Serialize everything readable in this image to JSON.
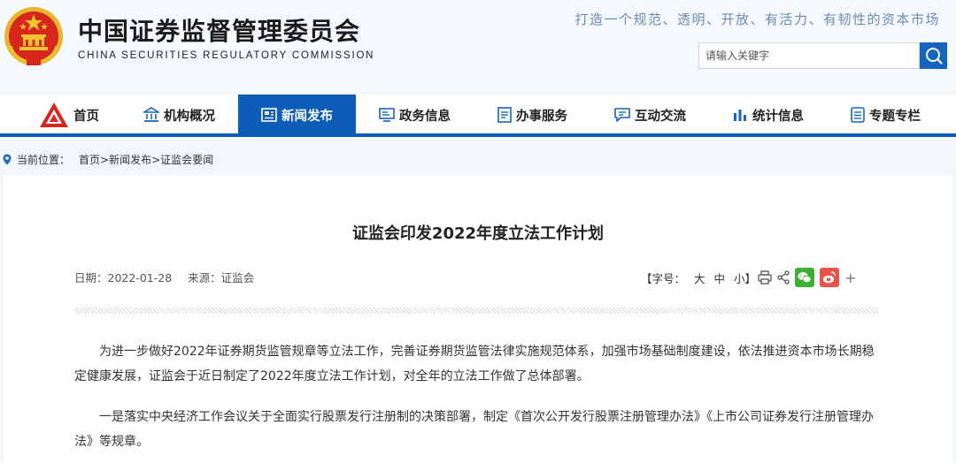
{
  "header": {
    "title": "中国证券监督管理委员会",
    "subtitle": "CHINA SECURITIES REGULATORY COMMISSION",
    "slogan": "打造一个规范、透明、开放、有活力、有韧性的资本市场"
  },
  "search": {
    "placeholder": "请输入关键字"
  },
  "nav": {
    "items": [
      {
        "label": "首页"
      },
      {
        "label": "机构概况"
      },
      {
        "label": "新闻发布"
      },
      {
        "label": "政务信息"
      },
      {
        "label": "办事服务"
      },
      {
        "label": "互动交流"
      },
      {
        "label": "统计信息"
      },
      {
        "label": "专题专栏"
      }
    ],
    "active_index": 2
  },
  "breadcrumb": {
    "prefix": "当前位置：",
    "path": "首页>新闻发布>证监会要闻"
  },
  "article": {
    "title": "证监会印发2022年度立法工作计划",
    "date": "日期：2022-01-28",
    "source": "来源：证监会",
    "font_label": "【字号：",
    "font_large": "大",
    "font_medium": "中",
    "font_small": "小】",
    "plus": "+",
    "paragraphs": [
      "为进一步做好2022年证券期货监管规章等立法工作，完善证券期货监管法律实施规范体系，加强市场基础制度建设，依法推进资本市场长期稳定健康发展，证监会于近日制定了2022年度立法工作计划，对全年的立法工作做了总体部署。",
      "一是落实中央经济工作会议关于全面实行股票发行注册制的决策部署，制定《首次公开发行股票注册管理办法》《上市公司证券发行注册管理办法》等规章。"
    ]
  },
  "colors": {
    "brand_blue": "#0d5db8",
    "emblem_red": "#d7261c",
    "emblem_gold": "#f4c430",
    "wechat_green": "#3cb034",
    "weibo_red": "#e6534b"
  }
}
